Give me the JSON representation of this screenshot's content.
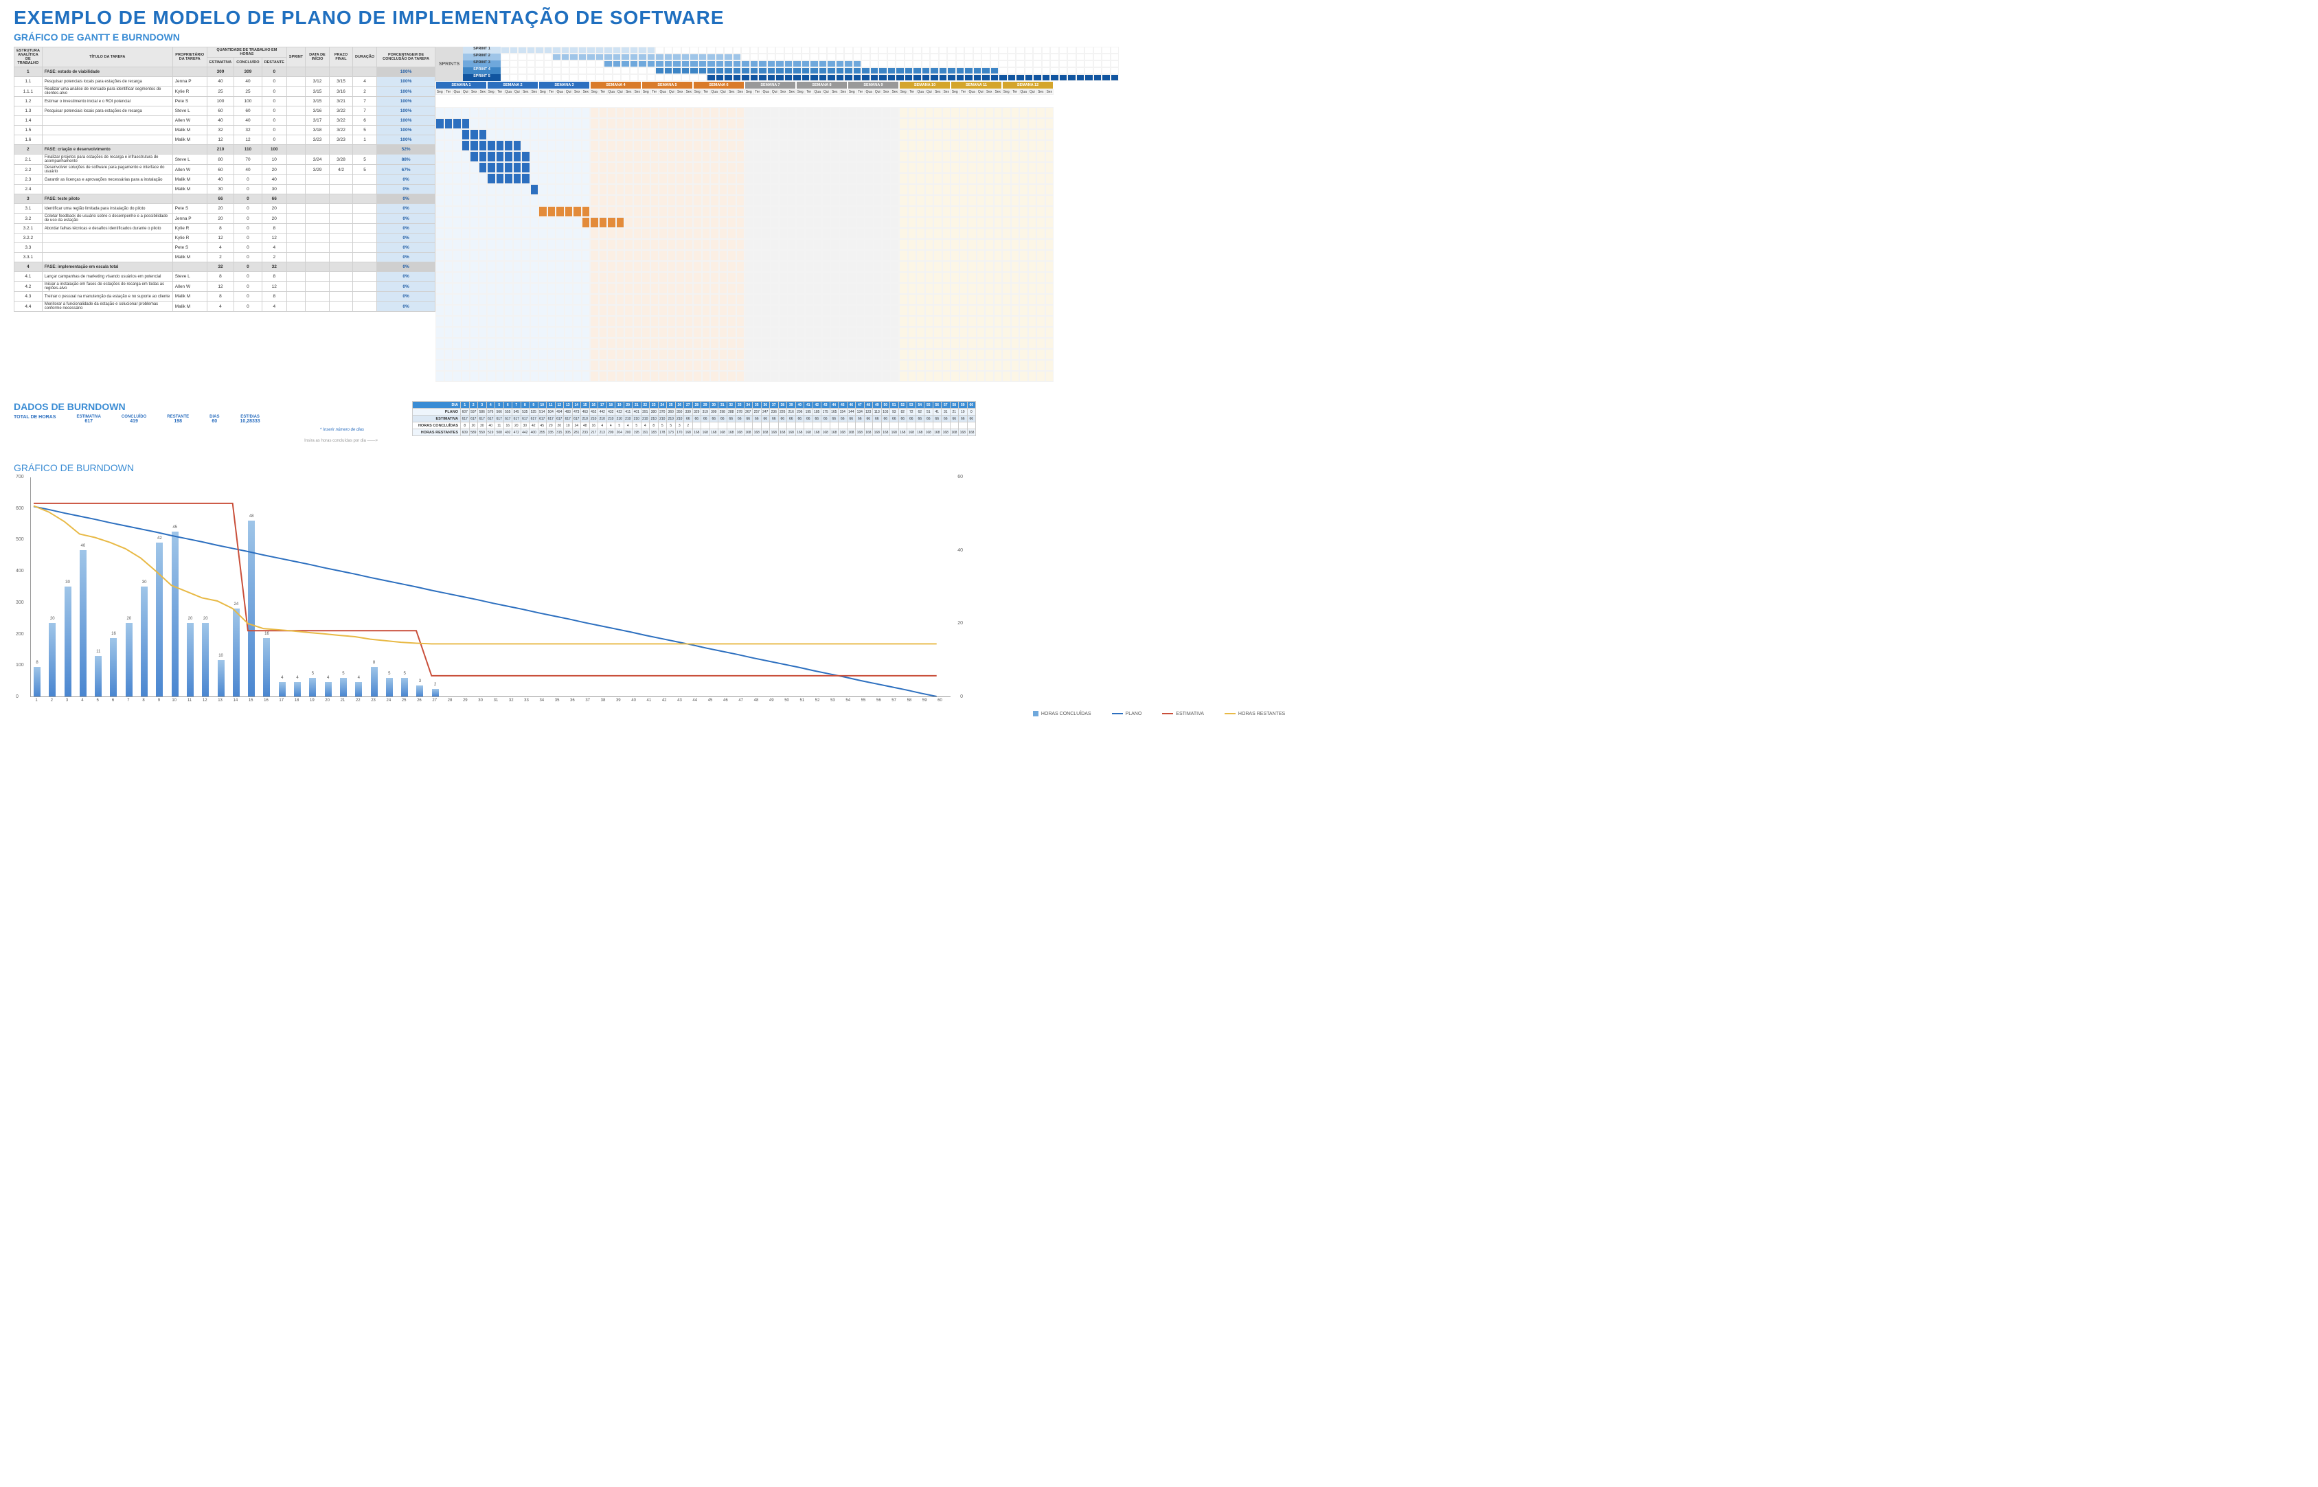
{
  "title": "EXEMPLO DE MODELO DE PLANO DE IMPLEMENTAÇÃO DE SOFTWARE",
  "subtitle_gantt": "GRÁFICO DE GANTT E BURNDOWN",
  "task_headers": {
    "wbs": "ESTRUTURA ANALÍTICA DE TRABALHO",
    "title": "TÍTULO DA TAREFA",
    "owner": "PROPRIETÁRIO DA TAREFA",
    "work_group": "QUANTIDADE DE TRABALHO EM HORAS",
    "est": "ESTIMATIVA",
    "done": "CONCLUÍDO",
    "rest": "RESTANTE",
    "sprint": "SPRINT",
    "start": "DATA DE INÍCIO",
    "end": "PRAZO FINAL",
    "dur": "DURAÇÃO",
    "pct": "PORCENTAGEM DE CONCLUSÃO DA TAREFA"
  },
  "sprints_label": "SPRINTS",
  "sprints": [
    "SPRINT 1",
    "SPRINT 2",
    "SPRINT 3",
    "SPRINT 4",
    "SPRINT 5"
  ],
  "weeks": [
    {
      "label": "SEMANA 1",
      "cls": "blue"
    },
    {
      "label": "SEMANA 2",
      "cls": "blue"
    },
    {
      "label": "SEMANA 3",
      "cls": "blue"
    },
    {
      "label": "SEMANA 4",
      "cls": "orange"
    },
    {
      "label": "SEMANA 5",
      "cls": "orange"
    },
    {
      "label": "SEMANA 6",
      "cls": "orange"
    },
    {
      "label": "SEMANA 7",
      "cls": "gray"
    },
    {
      "label": "SEMANA 8",
      "cls": "gray"
    },
    {
      "label": "SEMANA 9",
      "cls": "gray"
    },
    {
      "label": "SEMANA 10",
      "cls": "gold"
    },
    {
      "label": "SEMANA 11",
      "cls": "gold"
    },
    {
      "label": "SEMANA 12",
      "cls": "gold"
    }
  ],
  "day_labels": [
    "Seg",
    "Ter",
    "Qua",
    "Qui",
    "Sex",
    "Sex"
  ],
  "tasks": [
    {
      "wbs": "1",
      "title": "FASE: estudo de viabilidade",
      "owner": "",
      "est": 309,
      "done": 309,
      "rest": 0,
      "sprint": "",
      "start": "",
      "end": "",
      "dur": "",
      "pct": "100%",
      "phase": true,
      "gstart": 0,
      "glen": 0,
      "color": ""
    },
    {
      "wbs": "1.1",
      "title": "Pesquisar potenciais locais para estações de recarga",
      "owner": "Jenna P",
      "est": 40,
      "done": 40,
      "rest": 0,
      "sprint": "",
      "start": "3/12",
      "end": "3/15",
      "dur": 4,
      "pct": "100%",
      "gstart": 0,
      "glen": 4,
      "color": "db"
    },
    {
      "wbs": "1.1.1",
      "title": "Realizar uma análise de mercado para identificar segmentos de clientes-alvo",
      "owner": "Kylie R",
      "est": 25,
      "done": 25,
      "rest": 0,
      "sprint": "",
      "start": "3/15",
      "end": "3/16",
      "dur": 2,
      "pct": "100%",
      "gstart": 3,
      "glen": 3,
      "color": "db"
    },
    {
      "wbs": "1.2",
      "title": "Estimar o investimento inicial e o ROI potencial",
      "owner": "Pete S",
      "est": 100,
      "done": 100,
      "rest": 0,
      "sprint": "",
      "start": "3/15",
      "end": "3/21",
      "dur": 7,
      "pct": "100%",
      "gstart": 3,
      "glen": 7,
      "color": "db"
    },
    {
      "wbs": "1.3",
      "title": "Pesquisar potenciais locais para estações de recarga",
      "owner": "Steve L",
      "est": 60,
      "done": 60,
      "rest": 0,
      "sprint": "",
      "start": "3/16",
      "end": "3/22",
      "dur": 7,
      "pct": "100%",
      "gstart": 4,
      "glen": 7,
      "color": "db"
    },
    {
      "wbs": "1.4",
      "title": "",
      "owner": "Allen W",
      "est": 40,
      "done": 40,
      "rest": 0,
      "sprint": "",
      "start": "3/17",
      "end": "3/22",
      "dur": 6,
      "pct": "100%",
      "gstart": 5,
      "glen": 6,
      "color": "db"
    },
    {
      "wbs": "1.5",
      "title": "",
      "owner": "Malik M",
      "est": 32,
      "done": 32,
      "rest": 0,
      "sprint": "",
      "start": "3/18",
      "end": "3/22",
      "dur": 5,
      "pct": "100%",
      "gstart": 6,
      "glen": 5,
      "color": "db"
    },
    {
      "wbs": "1.6",
      "title": "",
      "owner": "Malik M",
      "est": 12,
      "done": 12,
      "rest": 0,
      "sprint": "",
      "start": "3/23",
      "end": "3/23",
      "dur": 1,
      "pct": "100%",
      "gstart": 11,
      "glen": 1,
      "color": "db"
    },
    {
      "wbs": "2",
      "title": "FASE: criação e desenvolvimento",
      "owner": "",
      "est": 210,
      "done": 110,
      "rest": 100,
      "sprint": "",
      "start": "",
      "end": "",
      "dur": "",
      "pct": "52%",
      "phase": true
    },
    {
      "wbs": "2.1",
      "title": "Finalizar projetos para estações de recarga e infraestrutura de acompanhamento",
      "owner": "Steve L",
      "est": 80,
      "done": 70,
      "rest": 10,
      "sprint": "",
      "start": "3/24",
      "end": "3/28",
      "dur": 5,
      "pct": "88%",
      "gstart": 12,
      "glen": 6,
      "color": "or"
    },
    {
      "wbs": "2.2",
      "title": "Desenvolver soluções de software para pagamento e interface do usuário",
      "owner": "Allen W",
      "est": 60,
      "done": 40,
      "rest": 20,
      "sprint": "",
      "start": "3/29",
      "end": "4/2",
      "dur": 5,
      "pct": "67%",
      "gstart": 17,
      "glen": 5,
      "color": "or"
    },
    {
      "wbs": "2.3",
      "title": "Garantir as licenças e aprovações necessárias para a instalação",
      "owner": "Malik M",
      "est": 40,
      "done": 0,
      "rest": 40,
      "sprint": "",
      "start": "",
      "end": "",
      "dur": "",
      "pct": "0%"
    },
    {
      "wbs": "2.4",
      "title": "",
      "owner": "Malik M",
      "est": 30,
      "done": 0,
      "rest": 30,
      "sprint": "",
      "start": "",
      "end": "",
      "dur": "",
      "pct": "0%"
    },
    {
      "wbs": "3",
      "title": "FASE: teste piloto",
      "owner": "",
      "est": 66,
      "done": 0,
      "rest": 66,
      "sprint": "",
      "start": "",
      "end": "",
      "dur": "",
      "pct": "0%",
      "phase": true
    },
    {
      "wbs": "3.1",
      "title": "Identificar uma região limitada para instalação do piloto",
      "owner": "Pete S",
      "est": 20,
      "done": 0,
      "rest": 20,
      "sprint": "",
      "start": "",
      "end": "",
      "dur": "",
      "pct": "0%"
    },
    {
      "wbs": "3.2",
      "title": "Coletar feedback do usuário sobre o desempenho e a possibilidade de uso da estação",
      "owner": "Jenna P",
      "est": 20,
      "done": 0,
      "rest": 20,
      "sprint": "",
      "start": "",
      "end": "",
      "dur": "",
      "pct": "0%"
    },
    {
      "wbs": "3.2.1",
      "title": "Abordar falhas técnicas e desafios identificados durante o piloto",
      "owner": "Kylie R",
      "est": 8,
      "done": 0,
      "rest": 8,
      "sprint": "",
      "start": "",
      "end": "",
      "dur": "",
      "pct": "0%"
    },
    {
      "wbs": "3.2.2",
      "title": "",
      "owner": "Kylie R",
      "est": 12,
      "done": 0,
      "rest": 12,
      "sprint": "",
      "start": "",
      "end": "",
      "dur": "",
      "pct": "0%"
    },
    {
      "wbs": "3.3",
      "title": "",
      "owner": "Pete S",
      "est": 4,
      "done": 0,
      "rest": 4,
      "sprint": "",
      "start": "",
      "end": "",
      "dur": "",
      "pct": "0%"
    },
    {
      "wbs": "3.3.1",
      "title": "",
      "owner": "Malik M",
      "est": 2,
      "done": 0,
      "rest": 2,
      "sprint": "",
      "start": "",
      "end": "",
      "dur": "",
      "pct": "0%"
    },
    {
      "wbs": "4",
      "title": "FASE: implementação em escala total",
      "owner": "",
      "est": 32,
      "done": 0,
      "rest": 32,
      "sprint": "",
      "start": "",
      "end": "",
      "dur": "",
      "pct": "0%",
      "phase": true
    },
    {
      "wbs": "4.1",
      "title": "Lançar campanhas de marketing visando usuários em potencial",
      "owner": "Steve L",
      "est": 8,
      "done": 0,
      "rest": 8,
      "sprint": "",
      "start": "",
      "end": "",
      "dur": "",
      "pct": "0%"
    },
    {
      "wbs": "4.2",
      "title": "Iniciar a instalação em fases de estações de recarga em todas as regiões-alvo",
      "owner": "Allen W",
      "est": 12,
      "done": 0,
      "rest": 12,
      "sprint": "",
      "start": "",
      "end": "",
      "dur": "",
      "pct": "0%"
    },
    {
      "wbs": "4.3",
      "title": "Treinar o pessoal na manutenção da estação e no suporte ao cliente",
      "owner": "Malik M",
      "est": 8,
      "done": 0,
      "rest": 8,
      "sprint": "",
      "start": "",
      "end": "",
      "dur": "",
      "pct": "0%"
    },
    {
      "wbs": "4.4",
      "title": "Monitorar a funcionalidade da estação e solucionar problemas conforme necessário",
      "owner": "Malik M",
      "est": 4,
      "done": 0,
      "rest": 4,
      "sprint": "",
      "start": "",
      "end": "",
      "dur": "",
      "pct": "0%"
    }
  ],
  "bd": {
    "title": "DADOS DE BURNDOWN",
    "total_label": "TOTAL DE HORAS",
    "col_labels": {
      "est": "ESTIMATIVA",
      "done": "CONCLUÍDO",
      "rest": "RESTANTE",
      "days": "DIAS",
      "estday": "EST/DIAS"
    },
    "totals": {
      "est": 617,
      "done": 419,
      "rest": 198,
      "days": 60,
      "estday": "10,28333"
    },
    "note1": "^ Inserir número de dias",
    "note2": "Insira as horas concluídas por dia ——>",
    "row_labels": {
      "dia": "DIA",
      "plano": "PLANO",
      "est": "ESTIMATIVA",
      "conc": "HORAS CONCLUÍDAS",
      "rest": "HORAS RESTANTES"
    },
    "days": [
      1,
      2,
      3,
      4,
      5,
      6,
      7,
      8,
      9,
      10,
      11,
      12,
      13,
      14,
      15,
      16,
      17,
      18,
      19,
      20,
      21,
      22,
      23,
      24,
      25,
      26,
      27,
      28,
      29,
      30,
      31,
      32,
      33,
      34,
      35,
      36,
      37,
      38,
      39,
      40,
      41,
      42,
      43,
      44,
      45,
      46,
      47,
      48,
      49,
      50,
      51,
      52,
      53,
      54,
      55,
      56,
      57,
      58,
      59,
      60
    ],
    "plano": [
      607,
      597,
      586,
      576,
      566,
      555,
      545,
      535,
      525,
      514,
      504,
      494,
      483,
      473,
      463,
      452,
      442,
      432,
      422,
      411,
      401,
      391,
      380,
      370,
      360,
      350,
      339,
      329,
      319,
      309,
      298,
      288,
      278,
      267,
      257,
      247,
      236,
      226,
      216,
      206,
      195,
      185,
      175,
      165,
      154,
      144,
      134,
      123,
      113,
      103,
      93,
      82,
      72,
      62,
      51,
      41,
      31,
      21,
      10,
      0
    ],
    "est": [
      617,
      617,
      617,
      617,
      617,
      617,
      617,
      617,
      617,
      617,
      617,
      617,
      617,
      617,
      210,
      210,
      210,
      210,
      210,
      210,
      210,
      210,
      210,
      210,
      210,
      210,
      66,
      66,
      66,
      66,
      66,
      66,
      66,
      66,
      66,
      66,
      66,
      66,
      66,
      66,
      66,
      66,
      66,
      66,
      66,
      66,
      66,
      66,
      66,
      66,
      66,
      66,
      66,
      66,
      66,
      66,
      66,
      66,
      66,
      66
    ],
    "conc": [
      8,
      20,
      30,
      40,
      11,
      16,
      20,
      30,
      42,
      45,
      20,
      20,
      10,
      24,
      48,
      16,
      4,
      4,
      5,
      4,
      5,
      4,
      8,
      5,
      5,
      3,
      2,
      "",
      "",
      "",
      "",
      "",
      "",
      "",
      "",
      "",
      "",
      "",
      "",
      "",
      "",
      "",
      "",
      "",
      "",
      "",
      "",
      "",
      "",
      "",
      "",
      "",
      "",
      "",
      "",
      "",
      "",
      "",
      "",
      ""
    ],
    "rest": [
      609,
      589,
      559,
      519,
      508,
      492,
      472,
      442,
      400,
      355,
      335,
      315,
      305,
      281,
      233,
      217,
      213,
      209,
      204,
      200,
      195,
      191,
      183,
      178,
      173,
      170,
      168,
      168,
      168,
      168,
      168,
      168,
      168,
      168,
      168,
      168,
      168,
      168,
      168,
      168,
      168,
      168,
      168,
      168,
      168,
      168,
      168,
      168,
      168,
      168,
      168,
      168,
      168,
      168,
      168,
      168,
      168,
      168,
      168,
      168
    ]
  },
  "chart_data": {
    "type": "bar+line",
    "title": "GRÁFICO DE BURNDOWN",
    "x": [
      1,
      2,
      3,
      4,
      5,
      6,
      7,
      8,
      9,
      10,
      11,
      12,
      13,
      14,
      15,
      16,
      17,
      18,
      19,
      20,
      21,
      22,
      23,
      24,
      25,
      26,
      27,
      28,
      29,
      30,
      31,
      32,
      33,
      34,
      35,
      36,
      37,
      38,
      39,
      40,
      41,
      42,
      43,
      44,
      45,
      46,
      47,
      48,
      49,
      50,
      51,
      52,
      53,
      54,
      55,
      56,
      57,
      58,
      59,
      60
    ],
    "bars": {
      "name": "HORAS CONCLUÍDAS",
      "values": [
        8,
        20,
        30,
        40,
        11,
        16,
        20,
        30,
        42,
        45,
        20,
        20,
        10,
        24,
        48,
        16,
        4,
        4,
        5,
        4,
        5,
        4,
        8,
        5,
        5,
        3,
        2,
        0,
        0,
        0,
        0,
        0,
        0,
        0,
        0,
        0,
        0,
        0,
        0,
        0,
        0,
        0,
        0,
        0,
        0,
        0,
        0,
        0,
        0,
        0,
        0,
        0,
        0,
        0,
        0,
        0,
        0,
        0,
        0,
        0
      ]
    },
    "series": [
      {
        "name": "PLANO",
        "color": "#2c6fbf",
        "values": [
          607,
          597,
          586,
          576,
          566,
          555,
          545,
          535,
          525,
          514,
          504,
          494,
          483,
          473,
          463,
          452,
          442,
          432,
          422,
          411,
          401,
          391,
          380,
          370,
          360,
          350,
          339,
          329,
          319,
          309,
          298,
          288,
          278,
          267,
          257,
          247,
          236,
          226,
          216,
          206,
          195,
          185,
          175,
          165,
          154,
          144,
          134,
          123,
          113,
          103,
          93,
          82,
          72,
          62,
          51,
          41,
          31,
          21,
          10,
          0
        ]
      },
      {
        "name": "ESTIMATIVA",
        "color": "#c94f3a",
        "values": [
          617,
          617,
          617,
          617,
          617,
          617,
          617,
          617,
          617,
          617,
          617,
          617,
          617,
          617,
          210,
          210,
          210,
          210,
          210,
          210,
          210,
          210,
          210,
          210,
          210,
          210,
          66,
          66,
          66,
          66,
          66,
          66,
          66,
          66,
          66,
          66,
          66,
          66,
          66,
          66,
          66,
          66,
          66,
          66,
          66,
          66,
          66,
          66,
          66,
          66,
          66,
          66,
          66,
          66,
          66,
          66,
          66,
          66,
          66,
          66
        ]
      },
      {
        "name": "HORAS RESTANTES",
        "color": "#e8b945",
        "values": [
          609,
          589,
          559,
          519,
          508,
          492,
          472,
          442,
          400,
          355,
          335,
          315,
          305,
          281,
          233,
          217,
          213,
          209,
          204,
          200,
          195,
          191,
          183,
          178,
          173,
          170,
          168,
          168,
          168,
          168,
          168,
          168,
          168,
          168,
          168,
          168,
          168,
          168,
          168,
          168,
          168,
          168,
          168,
          168,
          168,
          168,
          168,
          168,
          168,
          168,
          168,
          168,
          168,
          168,
          168,
          168,
          168,
          168,
          168,
          168
        ]
      }
    ],
    "ylim_left": [
      0,
      700
    ],
    "ylim_right": [
      0,
      60
    ],
    "legend": [
      "HORAS CONCLUÍDAS",
      "PLANO",
      "ESTIMATIVA",
      "HORAS RESTANTES"
    ]
  }
}
